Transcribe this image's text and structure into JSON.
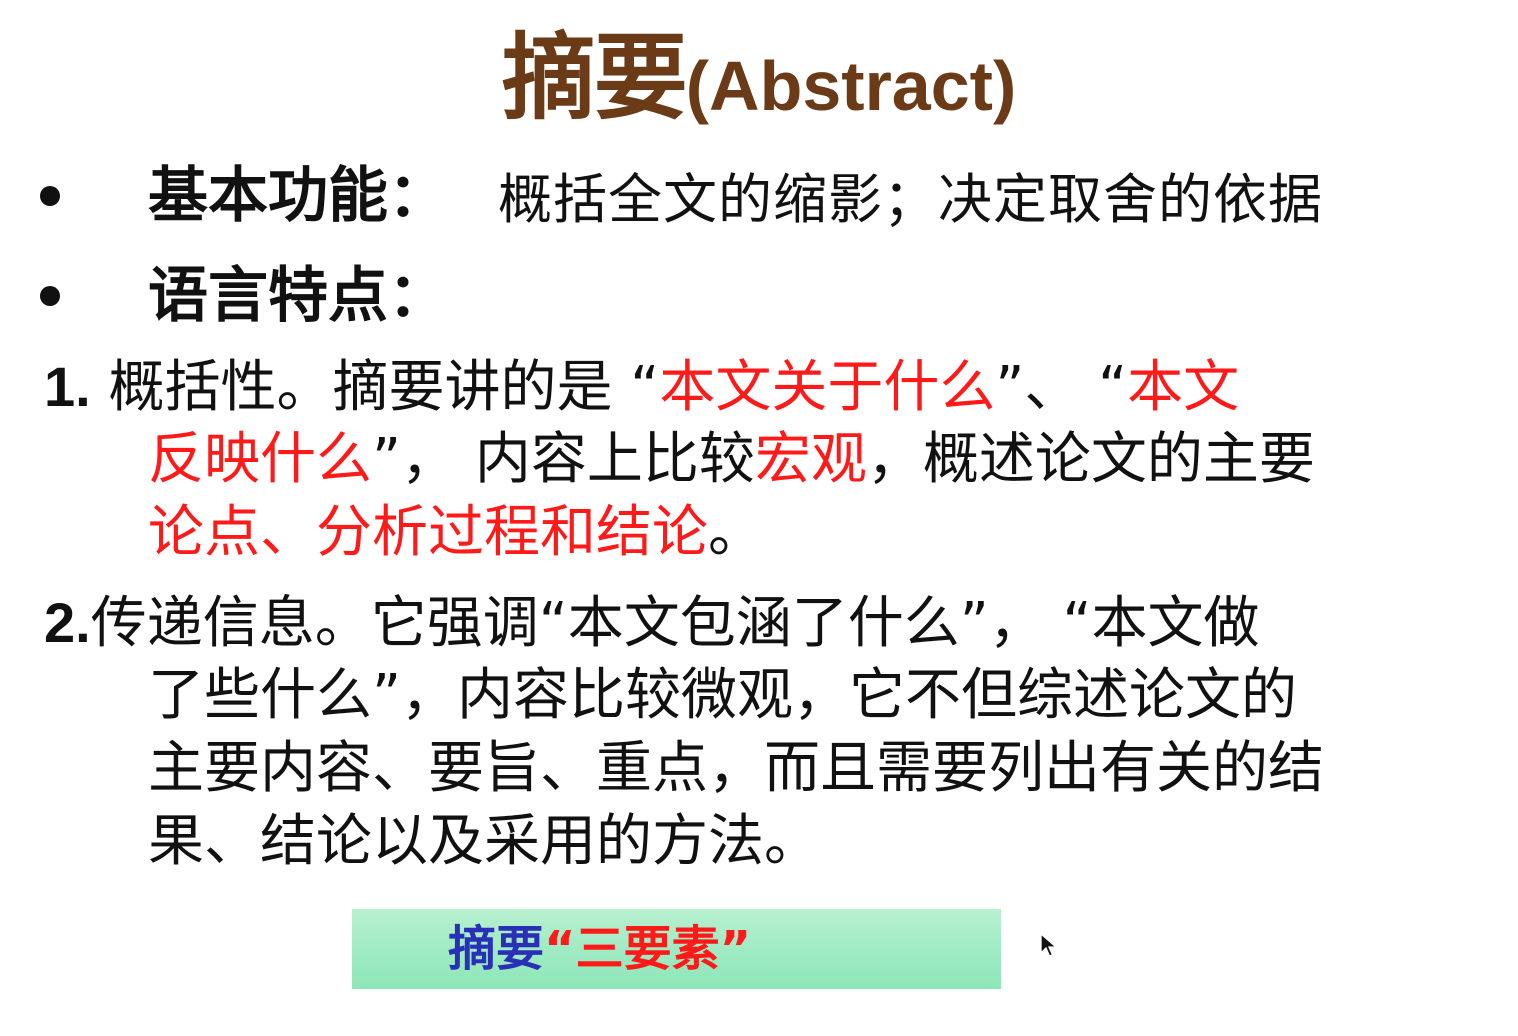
{
  "title": {
    "zh": "摘要",
    "en": "(Abstract)"
  },
  "bullets": [
    {
      "label": "基本功能：",
      "text": "概括全文的缩影；决定取舍的依据"
    },
    {
      "label": "语言特点：",
      "text": ""
    }
  ],
  "point1": {
    "number": "1.",
    "line1_a": " 概括性。摘要讲的是 “",
    "line1_red1": "本文关于什么",
    "line1_b": "”、 “",
    "line1_red2": "本文",
    "line2_red": "反映什么",
    "line2_a": "”， 内容上比较",
    "line2_red2": "宏观",
    "line2_b": "，概述论文的主要",
    "line3_red": "论点、分析过程和结论",
    "line3_a": "。"
  },
  "point2": {
    "number": "2.",
    "line1": "传递信息。它强调“本文包涵了什么”， “本文做",
    "line2": "了些什么”，内容比较微观，它不但综述论文的",
    "line3": "主要内容、要旨、重点，而且需要列出有关的结",
    "line4": "果、结论以及采用的方法。"
  },
  "summary_box": {
    "prefix": "摘要",
    "open_quote": "“",
    "highlight": "三要素",
    "close_quote": "”"
  },
  "colors": {
    "title": "#6b3a16",
    "highlight_red": "#ff1a1a",
    "box_blue_text": "#2a2fb8",
    "box_green": "#a5ecc6"
  },
  "icons": {
    "cursor": "mouse-pointer-icon"
  }
}
